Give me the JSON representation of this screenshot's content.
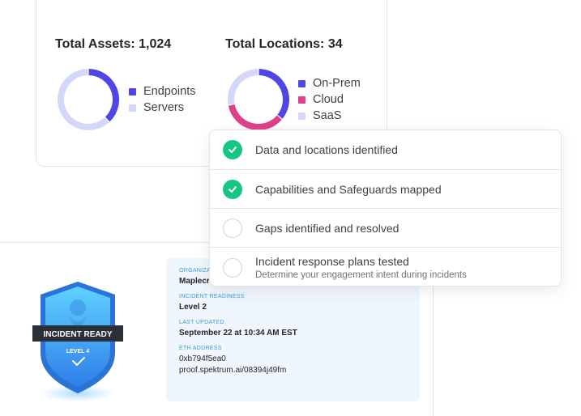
{
  "assets": {
    "title": "Total Assets: 1,024",
    "legend": [
      {
        "label": "Endpoints",
        "color": "#4f46e5",
        "fraction": 0.38
      },
      {
        "label": "Servers",
        "color": "#d4d8f8",
        "fraction": 0.62
      }
    ]
  },
  "locations": {
    "title": "Total Locations: 34",
    "legend": [
      {
        "label": "On-Prem",
        "color": "#4f46e5",
        "fraction": 0.36
      },
      {
        "label": "Cloud",
        "color": "#e0408a",
        "fraction": 0.36
      },
      {
        "label": "SaaS",
        "color": "#d4d8f8",
        "fraction": 0.28
      }
    ]
  },
  "checklist": [
    {
      "label": "Data and locations identified",
      "done": true,
      "sub": ""
    },
    {
      "label": "Capabilities and Safeguards mapped",
      "done": true,
      "sub": ""
    },
    {
      "label": "Gaps identified and resolved",
      "done": false,
      "sub": ""
    },
    {
      "label": "Incident response plans tested",
      "done": false,
      "sub": "Determine your engagement intent during incidents"
    }
  ],
  "badge": {
    "title": "INCIDENT READY",
    "level": "LEVEL 4"
  },
  "certificate": {
    "org_label": "ORGANIZA",
    "org_value": "Maplecr",
    "readiness_label": "INCIDENT READINESS",
    "readiness_value": "Level 2",
    "updated_label": "LAST UPDATED",
    "updated_value": "September 22 at 10:34 AM EST",
    "eth_label": "ETH ADDRESS",
    "eth_value": "0xb794f5ea0",
    "proof_value": "proof.spektrum.ai/08394j49fm"
  }
}
